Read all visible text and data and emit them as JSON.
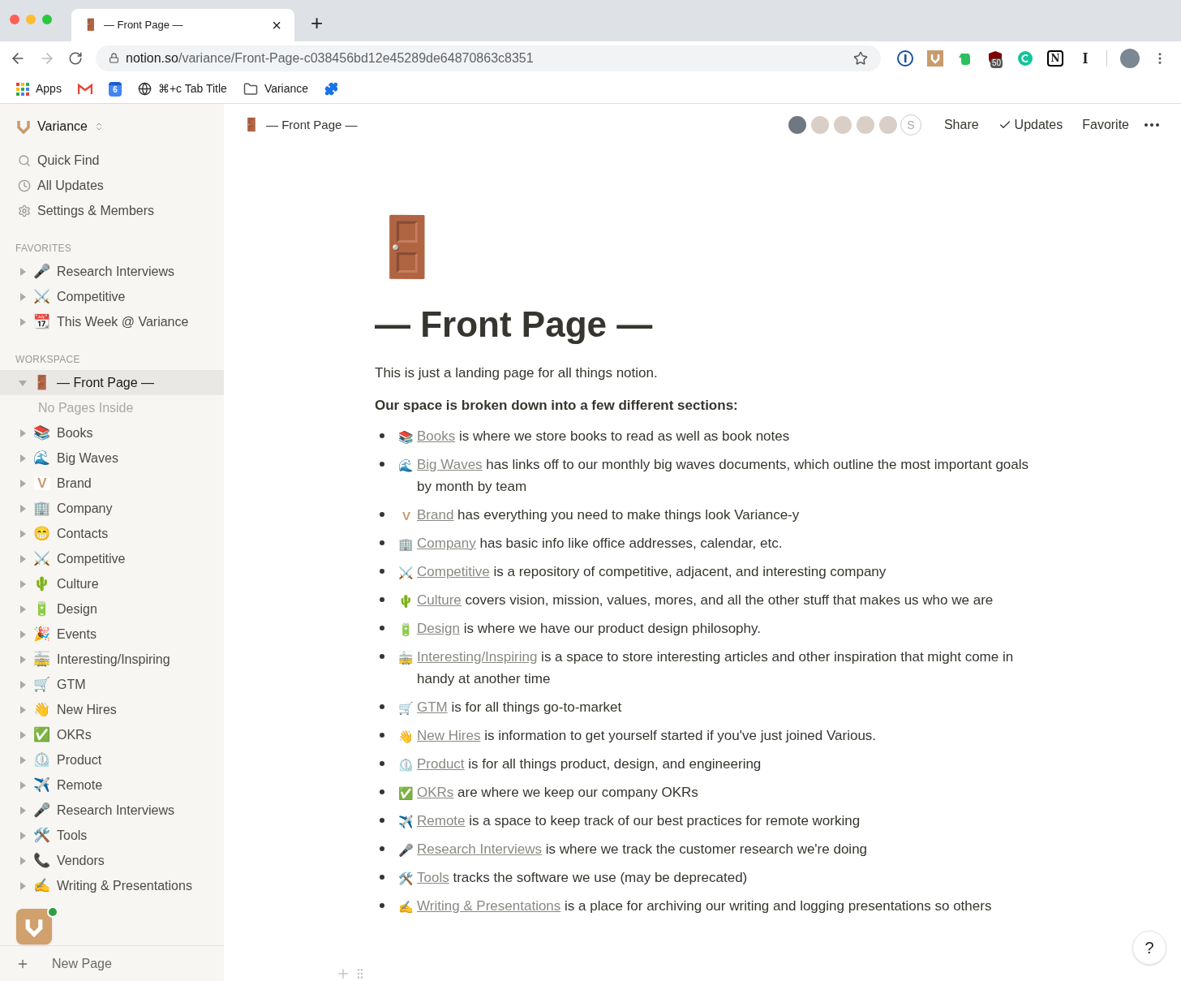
{
  "browser": {
    "tab": {
      "icon": "🚪",
      "title": "— Front Page —",
      "close": "×"
    },
    "new_tab": "+",
    "url": {
      "host": "notion.so",
      "path": "/variance/Front-Page-c038456bd12e45289de64870863c8351"
    },
    "extensions": [
      {
        "kind": "onepassword"
      },
      {
        "kind": "variance"
      },
      {
        "kind": "evernote"
      },
      {
        "kind": "ublock",
        "badge": "50"
      },
      {
        "kind": "grammarly"
      },
      {
        "kind": "notion",
        "glyph": "N"
      },
      {
        "kind": "instapaper",
        "glyph": "I"
      }
    ],
    "bookmarks": [
      {
        "kind": "apps",
        "label": "Apps"
      },
      {
        "kind": "gmail"
      },
      {
        "kind": "calendar",
        "label": "6"
      },
      {
        "kind": "globe",
        "label": "⌘+c Tab Title"
      },
      {
        "kind": "folder",
        "label": "Variance"
      },
      {
        "kind": "puzzle"
      }
    ]
  },
  "sidebar": {
    "workspace": "Variance",
    "nav": [
      {
        "kind": "search",
        "label": "Quick Find"
      },
      {
        "kind": "clock",
        "label": "All Updates"
      },
      {
        "kind": "gear",
        "label": "Settings & Members"
      }
    ],
    "favorites_heading": "FAVORITES",
    "favorites": [
      {
        "icon": "🎤",
        "label": "Research Interviews"
      },
      {
        "icon": "⚔️",
        "label": "Competitive"
      },
      {
        "icon": "📆",
        "label": "This Week @ Variance"
      }
    ],
    "workspace_heading": "WORKSPACE",
    "pages": [
      {
        "icon": "🚪",
        "label": "— Front Page —",
        "selected": true,
        "expanded": true,
        "empty_note": "No Pages Inside"
      },
      {
        "icon": "📚",
        "label": "Books",
        "selected": false,
        "expanded": false
      },
      {
        "icon": "🌊",
        "label": "Big Waves",
        "selected": false,
        "expanded": false
      },
      {
        "icon": "V",
        "label": "Brand",
        "selected": false,
        "expanded": false
      },
      {
        "icon": "🏢",
        "label": "Company",
        "selected": false,
        "expanded": false
      },
      {
        "icon": "😁",
        "label": "Contacts",
        "selected": false,
        "expanded": false
      },
      {
        "icon": "⚔️",
        "label": "Competitive",
        "selected": false,
        "expanded": false
      },
      {
        "icon": "🌵",
        "label": "Culture",
        "selected": false,
        "expanded": false
      },
      {
        "icon": "🔋",
        "label": "Design",
        "selected": false,
        "expanded": false
      },
      {
        "icon": "🎉",
        "label": "Events",
        "selected": false,
        "expanded": false
      },
      {
        "icon": "🚋",
        "label": "Interesting/Inspiring",
        "selected": false,
        "expanded": false
      },
      {
        "icon": "🛒",
        "label": "GTM",
        "selected": false,
        "expanded": false
      },
      {
        "icon": "👋",
        "label": "New Hires",
        "selected": false,
        "expanded": false
      },
      {
        "icon": "✅",
        "label": "OKRs",
        "selected": false,
        "expanded": false
      },
      {
        "icon": "⏲️",
        "label": "Product",
        "selected": false,
        "expanded": false
      },
      {
        "icon": "✈️",
        "label": "Remote",
        "selected": false,
        "expanded": false
      },
      {
        "icon": "🎤",
        "label": "Research Interviews",
        "selected": false,
        "expanded": false
      },
      {
        "icon": "🛠️",
        "label": "Tools",
        "selected": false,
        "expanded": false
      },
      {
        "icon": "📞",
        "label": "Vendors",
        "selected": false,
        "expanded": false
      },
      {
        "icon": "✍️",
        "label": "Writing & Presentations",
        "selected": false,
        "expanded": false
      }
    ],
    "new_page": "New Page"
  },
  "topbar": {
    "breadcrumb": {
      "icon": "🚪",
      "title": "— Front Page —"
    },
    "avatars": [
      {
        "kind": "photo"
      },
      {
        "kind": "photo"
      },
      {
        "kind": "photo"
      },
      {
        "kind": "photo"
      },
      {
        "kind": "photo"
      },
      {
        "kind": "letter",
        "letter": "S"
      }
    ],
    "share": "Share",
    "updates": "Updates",
    "favorite": "Favorite"
  },
  "page": {
    "icon": "🚪",
    "title": "— Front Page —",
    "intro": "This is just a landing page for all things notion.",
    "subheading": "Our space is broken down into a few different sections:",
    "bullets": [
      {
        "icon": "📚",
        "link": "Books",
        "text": " is where we store books to read as well as book notes"
      },
      {
        "icon": "🌊",
        "link": "Big Waves",
        "text": " has links off to our monthly big waves documents, which outline the most important goals by month by team"
      },
      {
        "icon": "V",
        "link": "Brand",
        "text": " has everything you need to make things look Variance-y"
      },
      {
        "icon": "🏢",
        "link": "Company",
        "text": " has basic info like office addresses, calendar, etc."
      },
      {
        "icon": "⚔️",
        "link": "Competitive",
        "text": " is a repository of competitive, adjacent, and interesting company"
      },
      {
        "icon": "🌵",
        "link": "Culture",
        "text": " covers vision, mission, values, mores, and all the other stuff that makes us who we are"
      },
      {
        "icon": "🔋",
        "link": "Design",
        "text": " is where we have our product design philosophy."
      },
      {
        "icon": "🚋",
        "link": "Interesting/Inspiring",
        "text": " is a space to store interesting articles and other inspiration that might come in handy at another time"
      },
      {
        "icon": "🛒",
        "link": "GTM",
        "text": " is for all things go-to-market"
      },
      {
        "icon": "👋",
        "link": "New Hires",
        "text": " is information to get yourself started if you've just joined Various."
      },
      {
        "icon": "⏲️",
        "link": "Product",
        "text": " is for all things product, design, and engineering"
      },
      {
        "icon": "✅",
        "link": "OKRs",
        "text": " are where we keep our company OKRs"
      },
      {
        "icon": "✈️",
        "link": "Remote",
        "text": " is a space to keep track of our best practices for remote working"
      },
      {
        "icon": "🎤",
        "link": "Research Interviews",
        "text": " is where we track the customer research we're doing"
      },
      {
        "icon": "🛠️",
        "link": "Tools",
        "text": " tracks the software we use (may be deprecated)"
      },
      {
        "icon": "✍️",
        "link": "Writing & Presentations",
        "text": " is a place for archiving our writing and logging presentations so others"
      }
    ]
  },
  "help": "?"
}
